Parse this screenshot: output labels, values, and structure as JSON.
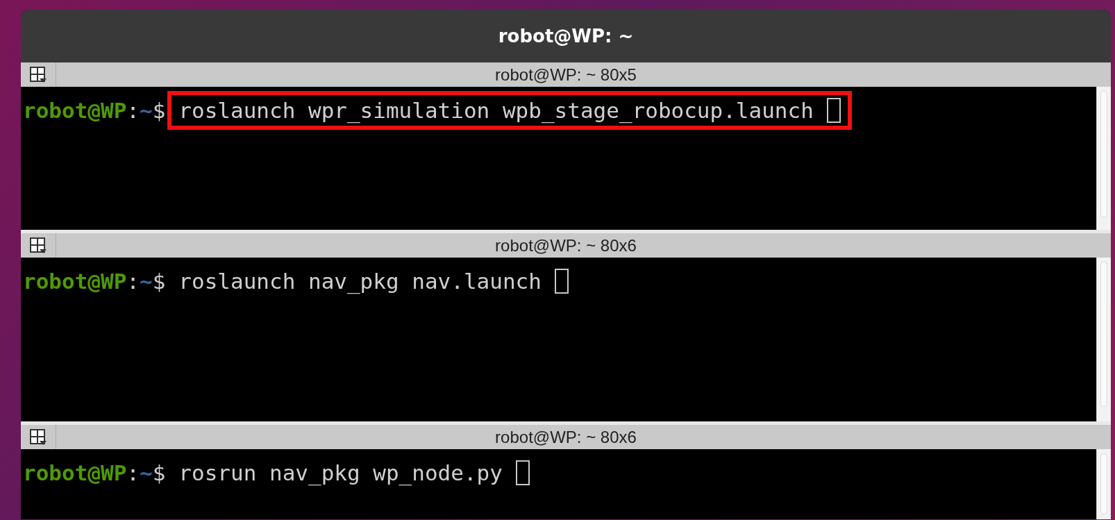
{
  "window": {
    "title": "robot@WP: ~"
  },
  "panes": [
    {
      "title": "robot@WP: ~ 80x5",
      "user": "robot@WP",
      "separator": ":",
      "path": "~",
      "symbol": "$",
      "command": "roslaunch wpr_simulation wpb_stage_robocup.launch",
      "highlighted": true
    },
    {
      "title": "robot@WP: ~ 80x6",
      "user": "robot@WP",
      "separator": ":",
      "path": "~",
      "symbol": "$",
      "command": "roslaunch nav_pkg nav.launch",
      "highlighted": false
    },
    {
      "title": "robot@WP: ~ 80x6",
      "user": "robot@WP",
      "separator": ":",
      "path": "~",
      "symbol": "$",
      "command": "rosrun nav_pkg wp_node.py",
      "highlighted": false
    }
  ]
}
